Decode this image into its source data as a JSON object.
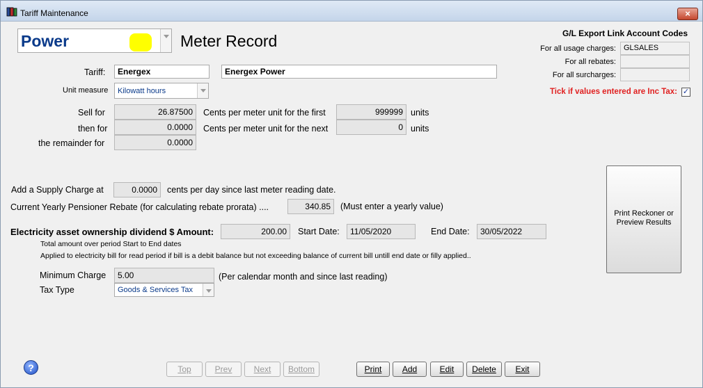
{
  "window": {
    "title": "Tariff Maintenance",
    "close_label": "×"
  },
  "header": {
    "utility": "Power",
    "record_title": "Meter Record"
  },
  "gl": {
    "heading": "G/L Export Link Account Codes",
    "usage_label": "For all usage charges:",
    "usage_value": "GLSALES",
    "rebates_label": "For all rebates:",
    "rebates_value": "",
    "surcharges_label": "For all surcharges:",
    "surcharges_value": "",
    "inc_tax_label": "Tick if values entered are Inc Tax:",
    "inc_tax_checked": true,
    "check_mark": "✓"
  },
  "tariff": {
    "label": "Tariff:",
    "code": "Energex",
    "name": "Energex Power"
  },
  "unit": {
    "label": "Unit measure",
    "value": "Kilowatt hours"
  },
  "rates": {
    "sell_label": "Sell for",
    "sell_value": "26.87500",
    "then_label": "then for",
    "then_value": "0.0000",
    "rem_label": "the remainder for",
    "rem_value": "0.0000",
    "first_label": "Cents per meter unit for the first",
    "first_value": "999999",
    "next_label": "Cents per meter unit for the next",
    "next_value": "0",
    "units1": "units",
    "units2": "units"
  },
  "supply": {
    "label": "Add a Supply Charge at",
    "value": "0.0000",
    "suffix": "cents per day since last meter reading date."
  },
  "pension": {
    "label": "Current Yearly Pensioner Rebate (for calculating rebate prorata) ....",
    "value": "340.85",
    "suffix": "(Must enter a yearly value)"
  },
  "dividend": {
    "label": "Electricity asset ownership dividend $ Amount:",
    "value": "200.00",
    "start_label": "Start Date:",
    "start_value": "11/05/2020",
    "end_label": "End Date:",
    "end_value": "30/05/2022",
    "note1": "Total amount over period Start to End dates",
    "note2": "Applied to electricity bill for read period if bill is a debit balance but not exceeding balance of current bill untill end date or filly applied.."
  },
  "minimum": {
    "label": "Minimum Charge",
    "value": "5.00",
    "suffix": "(Per calendar month and since last reading)"
  },
  "tax": {
    "label": "Tax Type",
    "value": "Goods & Services Tax"
  },
  "reckoner_button": "Print Reckoner or Preview Results",
  "help_icon_text": "?",
  "nav": {
    "top": "Top",
    "prev": "Prev",
    "next": "Next",
    "bottom": "Bottom"
  },
  "actions": {
    "print": "Print",
    "add": "Add",
    "edit": "Edit",
    "delete": "Delete",
    "exit": "Exit"
  },
  "colors": {
    "accent": "#0a3a8a",
    "warning": "#e02020",
    "highlight": "#ffff00"
  }
}
